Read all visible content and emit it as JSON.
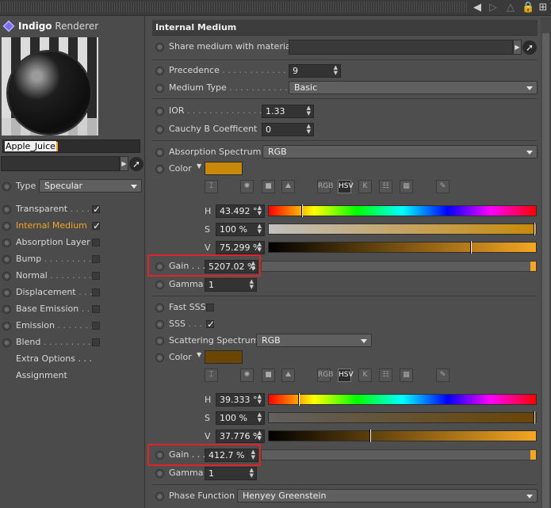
{
  "brand": {
    "name_bold": "Indigo",
    "name_rest": " Renderer"
  },
  "material": {
    "name": "Apple_Juice"
  },
  "left": {
    "type_label": "Type",
    "type_value": "Specular",
    "channels": [
      {
        "label": "Transparent",
        "dots": " . . . . .",
        "checked": true,
        "active": false
      },
      {
        "label": "Internal Medium",
        "dots": "",
        "checked": true,
        "active": true
      },
      {
        "label": "Absorption Layer",
        "dots": "",
        "checked": false,
        "active": false
      },
      {
        "label": "Bump",
        "dots": " . . . . . . . . . .",
        "checked": false,
        "active": false
      },
      {
        "label": "Normal",
        "dots": " . . . . . . . . .",
        "checked": false,
        "active": false
      },
      {
        "label": "Displacement",
        "dots": " . . .",
        "checked": false,
        "active": false
      },
      {
        "label": "Base Emission",
        "dots": " . . .",
        "checked": false,
        "active": false
      },
      {
        "label": "Emission",
        "dots": " . . . . . . .",
        "checked": false,
        "active": false
      },
      {
        "label": "Blend",
        "dots": " . . . . . . . . . .",
        "checked": false,
        "active": false
      }
    ],
    "extra_options": "Extra Options . . .",
    "assignment": "Assignment"
  },
  "panel": {
    "title": "Internal Medium",
    "share_label": "Share medium with material",
    "precedence_label": "Precedence",
    "precedence_dots": " . . . . . . . . . . . . . .",
    "precedence_value": "9",
    "medium_type_label": "Medium Type",
    "medium_type_dots": " . . . . . . . . . . .",
    "medium_type_value": "Basic",
    "ior_label": "IOR",
    "ior_dots": " . . . . . . . . . . . . . . .",
    "ior_value": "1.33",
    "cauchy_label": "Cauchy B Coefficent",
    "cauchy_value": "0",
    "absorption_label": "Absorption Spectrum",
    "absorption_value": "RGB",
    "color_label": "Color",
    "abs_color": {
      "swatch": "#c8890a",
      "H_label": "H",
      "H": "43.492 °",
      "S_label": "S",
      "S": "100 %",
      "V_label": "V",
      "V": "75.299 %",
      "h_frac": 0.121,
      "s_frac": 1.0,
      "v_frac": 0.753
    },
    "gain_label": "Gain . . .",
    "abs_gain": "5207.02 %",
    "gamma_label": "Gamma",
    "abs_gamma": "1",
    "fast_sss_label": "Fast SSS",
    "sss_label": "SSS",
    "sss_dots": " . . . . .",
    "scattering_label": "Scattering Spectrum",
    "scattering_value": "RGB",
    "scat_color": {
      "swatch": "#6a4504",
      "H": "39.333 °",
      "S": "100 %",
      "V": "37.776 %",
      "h_frac": 0.109,
      "s_frac": 1.0,
      "v_frac": 0.378
    },
    "scat_gain": "412.7 %",
    "scat_gamma": "1",
    "phase_label": "Phase Function",
    "phase_value": "Henyey Greenstein",
    "mode_buttons": [
      "RGB",
      "HSV",
      "K"
    ]
  },
  "colors": {
    "accent": "#f5a623",
    "highlight_box": "#e0232b"
  }
}
